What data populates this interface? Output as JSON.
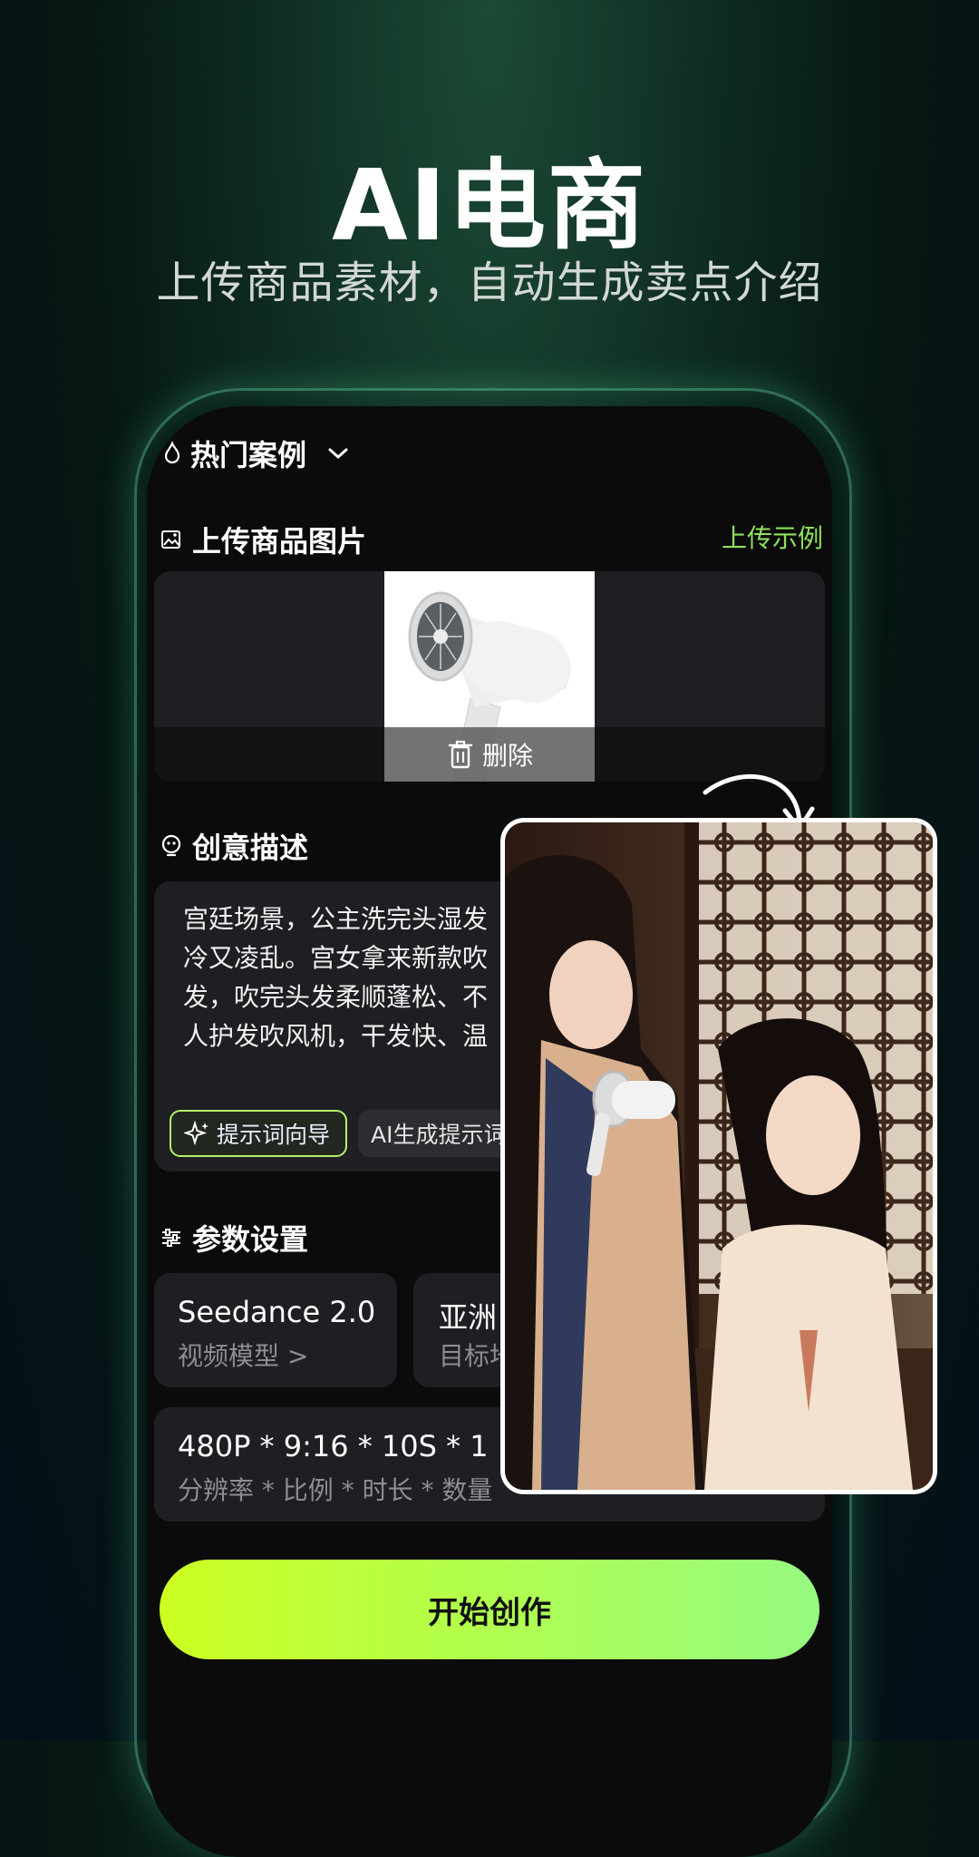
{
  "hero": {
    "title": "AI电商",
    "subtitle": "上传商品素材，自动生成卖点介绍"
  },
  "hot_cases": {
    "label": "热门案例",
    "icon": "flame-icon",
    "chevron": "chevron-down-icon"
  },
  "upload": {
    "section_label": "上传商品图片",
    "icon": "image-icon",
    "example_link": "上传示例",
    "delete_label": "删除"
  },
  "creative": {
    "section_label": "创意描述",
    "icon": "bulb-icon",
    "prompt_text": "宫廷场景，公主洗完头湿发\n冷又凌乱。宫女拿来新款吹\n发，吹完头发柔顺蓬松、不\n人护发吹风机，干发快、温",
    "chip_guide": "提示词向导",
    "chip_ai": "AI生成提示词"
  },
  "params": {
    "section_label": "参数设置",
    "icon": "sliders-icon",
    "model_value": "Seedance 2.0",
    "model_label": "视频模型 >",
    "region_value": "亚洲",
    "region_label": "目标地",
    "spec_value": "480P * 9:16 * 10S * 1",
    "spec_label": "分辨率 * 比例 * 时长 * 数量"
  },
  "start_button": "开始创作",
  "colors": {
    "accent_green": "#8ee25c",
    "button_start": "#ccff22",
    "button_end": "#95fa80"
  }
}
